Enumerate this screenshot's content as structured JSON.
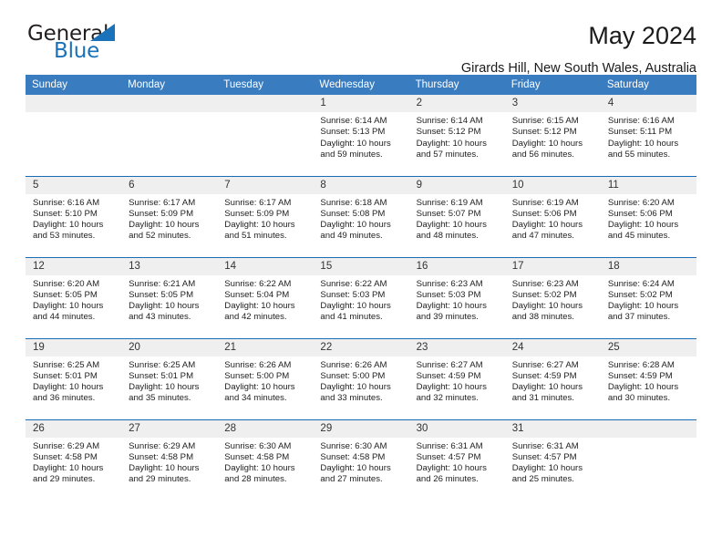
{
  "brand": {
    "name_part1": "General",
    "name_part2": "Blue",
    "accent_color": "#1a72ba"
  },
  "header": {
    "title": "May 2024",
    "subtitle": "Girards Hill, New South Wales, Australia"
  },
  "calendar": {
    "header_bg": "#3a7cc0",
    "weekday_headers": [
      "Sunday",
      "Monday",
      "Tuesday",
      "Wednesday",
      "Thursday",
      "Friday",
      "Saturday"
    ],
    "labels": {
      "sunrise": "Sunrise:",
      "sunset": "Sunset:",
      "daylight": "Daylight:"
    },
    "weeks": [
      [
        {
          "day": "",
          "blank": true
        },
        {
          "day": "",
          "blank": true
        },
        {
          "day": "",
          "blank": true
        },
        {
          "day": "1",
          "sunrise": "Sunrise: 6:14 AM",
          "sunset": "Sunset: 5:13 PM",
          "daylight": "Daylight: 10 hours and 59 minutes."
        },
        {
          "day": "2",
          "sunrise": "Sunrise: 6:14 AM",
          "sunset": "Sunset: 5:12 PM",
          "daylight": "Daylight: 10 hours and 57 minutes."
        },
        {
          "day": "3",
          "sunrise": "Sunrise: 6:15 AM",
          "sunset": "Sunset: 5:12 PM",
          "daylight": "Daylight: 10 hours and 56 minutes."
        },
        {
          "day": "4",
          "sunrise": "Sunrise: 6:16 AM",
          "sunset": "Sunset: 5:11 PM",
          "daylight": "Daylight: 10 hours and 55 minutes."
        }
      ],
      [
        {
          "day": "5",
          "sunrise": "Sunrise: 6:16 AM",
          "sunset": "Sunset: 5:10 PM",
          "daylight": "Daylight: 10 hours and 53 minutes."
        },
        {
          "day": "6",
          "sunrise": "Sunrise: 6:17 AM",
          "sunset": "Sunset: 5:09 PM",
          "daylight": "Daylight: 10 hours and 52 minutes."
        },
        {
          "day": "7",
          "sunrise": "Sunrise: 6:17 AM",
          "sunset": "Sunset: 5:09 PM",
          "daylight": "Daylight: 10 hours and 51 minutes."
        },
        {
          "day": "8",
          "sunrise": "Sunrise: 6:18 AM",
          "sunset": "Sunset: 5:08 PM",
          "daylight": "Daylight: 10 hours and 49 minutes."
        },
        {
          "day": "9",
          "sunrise": "Sunrise: 6:19 AM",
          "sunset": "Sunset: 5:07 PM",
          "daylight": "Daylight: 10 hours and 48 minutes."
        },
        {
          "day": "10",
          "sunrise": "Sunrise: 6:19 AM",
          "sunset": "Sunset: 5:06 PM",
          "daylight": "Daylight: 10 hours and 47 minutes."
        },
        {
          "day": "11",
          "sunrise": "Sunrise: 6:20 AM",
          "sunset": "Sunset: 5:06 PM",
          "daylight": "Daylight: 10 hours and 45 minutes."
        }
      ],
      [
        {
          "day": "12",
          "sunrise": "Sunrise: 6:20 AM",
          "sunset": "Sunset: 5:05 PM",
          "daylight": "Daylight: 10 hours and 44 minutes."
        },
        {
          "day": "13",
          "sunrise": "Sunrise: 6:21 AM",
          "sunset": "Sunset: 5:05 PM",
          "daylight": "Daylight: 10 hours and 43 minutes."
        },
        {
          "day": "14",
          "sunrise": "Sunrise: 6:22 AM",
          "sunset": "Sunset: 5:04 PM",
          "daylight": "Daylight: 10 hours and 42 minutes."
        },
        {
          "day": "15",
          "sunrise": "Sunrise: 6:22 AM",
          "sunset": "Sunset: 5:03 PM",
          "daylight": "Daylight: 10 hours and 41 minutes."
        },
        {
          "day": "16",
          "sunrise": "Sunrise: 6:23 AM",
          "sunset": "Sunset: 5:03 PM",
          "daylight": "Daylight: 10 hours and 39 minutes."
        },
        {
          "day": "17",
          "sunrise": "Sunrise: 6:23 AM",
          "sunset": "Sunset: 5:02 PM",
          "daylight": "Daylight: 10 hours and 38 minutes."
        },
        {
          "day": "18",
          "sunrise": "Sunrise: 6:24 AM",
          "sunset": "Sunset: 5:02 PM",
          "daylight": "Daylight: 10 hours and 37 minutes."
        }
      ],
      [
        {
          "day": "19",
          "sunrise": "Sunrise: 6:25 AM",
          "sunset": "Sunset: 5:01 PM",
          "daylight": "Daylight: 10 hours and 36 minutes."
        },
        {
          "day": "20",
          "sunrise": "Sunrise: 6:25 AM",
          "sunset": "Sunset: 5:01 PM",
          "daylight": "Daylight: 10 hours and 35 minutes."
        },
        {
          "day": "21",
          "sunrise": "Sunrise: 6:26 AM",
          "sunset": "Sunset: 5:00 PM",
          "daylight": "Daylight: 10 hours and 34 minutes."
        },
        {
          "day": "22",
          "sunrise": "Sunrise: 6:26 AM",
          "sunset": "Sunset: 5:00 PM",
          "daylight": "Daylight: 10 hours and 33 minutes."
        },
        {
          "day": "23",
          "sunrise": "Sunrise: 6:27 AM",
          "sunset": "Sunset: 4:59 PM",
          "daylight": "Daylight: 10 hours and 32 minutes."
        },
        {
          "day": "24",
          "sunrise": "Sunrise: 6:27 AM",
          "sunset": "Sunset: 4:59 PM",
          "daylight": "Daylight: 10 hours and 31 minutes."
        },
        {
          "day": "25",
          "sunrise": "Sunrise: 6:28 AM",
          "sunset": "Sunset: 4:59 PM",
          "daylight": "Daylight: 10 hours and 30 minutes."
        }
      ],
      [
        {
          "day": "26",
          "sunrise": "Sunrise: 6:29 AM",
          "sunset": "Sunset: 4:58 PM",
          "daylight": "Daylight: 10 hours and 29 minutes."
        },
        {
          "day": "27",
          "sunrise": "Sunrise: 6:29 AM",
          "sunset": "Sunset: 4:58 PM",
          "daylight": "Daylight: 10 hours and 29 minutes."
        },
        {
          "day": "28",
          "sunrise": "Sunrise: 6:30 AM",
          "sunset": "Sunset: 4:58 PM",
          "daylight": "Daylight: 10 hours and 28 minutes."
        },
        {
          "day": "29",
          "sunrise": "Sunrise: 6:30 AM",
          "sunset": "Sunset: 4:58 PM",
          "daylight": "Daylight: 10 hours and 27 minutes."
        },
        {
          "day": "30",
          "sunrise": "Sunrise: 6:31 AM",
          "sunset": "Sunset: 4:57 PM",
          "daylight": "Daylight: 10 hours and 26 minutes."
        },
        {
          "day": "31",
          "sunrise": "Sunrise: 6:31 AM",
          "sunset": "Sunset: 4:57 PM",
          "daylight": "Daylight: 10 hours and 25 minutes."
        },
        {
          "day": "",
          "blank": true
        }
      ]
    ]
  }
}
